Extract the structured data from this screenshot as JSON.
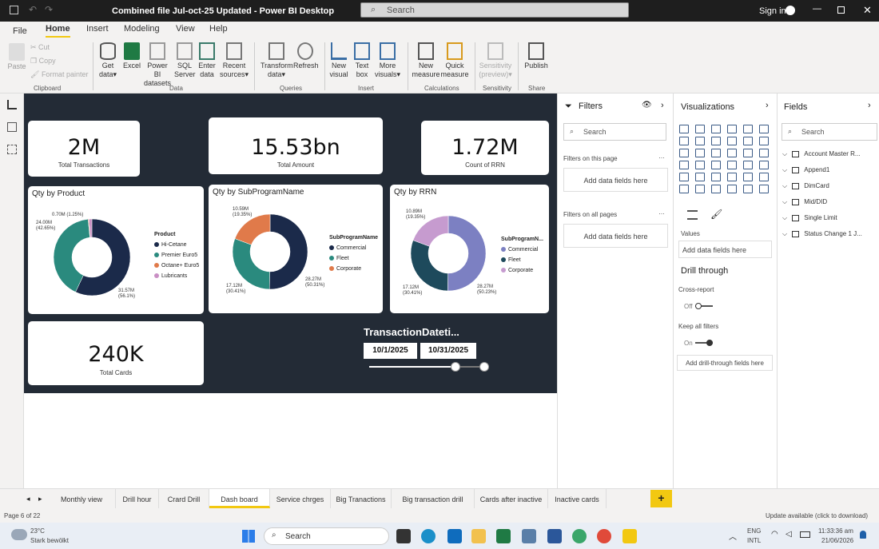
{
  "titlebar": {
    "title": "Combined file Jul-oct-25 Updated - Power BI Desktop",
    "search_placeholder": "Search",
    "signin": "Sign in"
  },
  "menu": {
    "tabs": [
      "File",
      "Home",
      "Insert",
      "Modeling",
      "View",
      "Help"
    ],
    "active": "Home"
  },
  "ribbon": {
    "clipboard": {
      "paste": "Paste",
      "cut": "Cut",
      "copy": "Copy",
      "format_painter": "Format painter",
      "group": "Clipboard"
    },
    "data": {
      "get_data": "Get",
      "get_data2": "data",
      "excel": "Excel",
      "pbi1": "Power BI",
      "pbi2": "datasets",
      "sql1": "SQL",
      "sql2": "Server",
      "enter1": "Enter",
      "enter2": "data",
      "recent1": "Recent",
      "recent2": "sources",
      "group": "Data"
    },
    "queries": {
      "transform1": "Transform",
      "transform2": "data",
      "refresh": "Refresh",
      "group": "Queries"
    },
    "insert": {
      "newvisual1": "New",
      "newvisual2": "visual",
      "textbox1": "Text",
      "textbox2": "box",
      "more1": "More",
      "more2": "visuals",
      "group": "Insert"
    },
    "calculations": {
      "newmeasure1": "New",
      "newmeasure2": "measure",
      "quick1": "Quick",
      "quick2": "measure",
      "group": "Calculations"
    },
    "sensitivity": {
      "s1": "Sensitivity",
      "s2": "(preview)",
      "group": "Sensitivity"
    },
    "share": {
      "publish": "Publish",
      "group": "Share"
    }
  },
  "report": {
    "kpis": [
      {
        "value": "2M",
        "label": "Total Transactions"
      },
      {
        "value": "15.53bn",
        "label": "Total Amount"
      },
      {
        "value": "1.72M",
        "label": "Count of RRN"
      },
      {
        "value": "240K",
        "label": "Total Cards"
      }
    ],
    "slicer": {
      "title": "TransactionDateti...",
      "start": "10/1/2025",
      "end": "10/31/2025",
      "range_fill_fraction": 0.75
    }
  },
  "chart_data": [
    {
      "type": "pie",
      "title": "Qty by Product",
      "legend_title": "Product",
      "categories": [
        "Hi-Cetane",
        "Premier Euro5",
        "Octane+ Euro5",
        "Lubricants"
      ],
      "colors": [
        "#1b2a4a",
        "#2a8a7e",
        "#e07a4a",
        "#c98fc4"
      ],
      "values": [
        1.157,
        0.84,
        0.007,
        0.025
      ],
      "data_labels": [
        {
          "text": "31.57M",
          "pct": "(56.1%)"
        },
        {
          "text": "24.00M",
          "pct": "(42.65%)"
        },
        {
          "text": "0.70M (1.25%)",
          "pct": ""
        }
      ]
    },
    {
      "type": "pie",
      "title": "Qty by SubProgramName",
      "legend_title": "SubProgramName",
      "categories": [
        "Commercial",
        "Fleet",
        "Corporate"
      ],
      "colors": [
        "#1b2a4a",
        "#2a8a7e",
        "#e07a4a"
      ],
      "values": [
        50.31,
        30.41,
        19.35
      ],
      "data_labels": [
        {
          "text": "28.27M",
          "pct": "(50.31%)"
        },
        {
          "text": "17.12M",
          "pct": "(30.41%)"
        },
        {
          "text": "10.59M",
          "pct": "(19.35%)"
        }
      ]
    },
    {
      "type": "pie",
      "title": "Qty by RRN",
      "legend_title": "SubProgramN...",
      "categories": [
        "Commercial",
        "Fleet",
        "Corporate"
      ],
      "colors": [
        "#7c80c2",
        "#1e4a5c",
        "#c69bcf"
      ],
      "values": [
        50.23,
        30.41,
        19.35
      ],
      "data_labels": [
        {
          "text": "28.27M",
          "pct": "(50.23%)"
        },
        {
          "text": "17.12M",
          "pct": "(30.41%)"
        },
        {
          "text": "10.89M",
          "pct": "(19.35%)"
        }
      ]
    }
  ],
  "filters": {
    "title": "Filters",
    "search": "Search",
    "on_page": "Filters on this page",
    "on_all": "Filters on all pages",
    "add": "Add data fields here"
  },
  "visualizations": {
    "title": "Visualizations",
    "values": "Values",
    "add_values": "Add data fields here",
    "drill": "Drill through",
    "cross": "Cross-report",
    "off": "Off",
    "keep": "Keep all filters",
    "on": "On",
    "add_drill": "Add drill-through fields here"
  },
  "fields": {
    "title": "Fields",
    "search": "Search",
    "tables": [
      "Account Master R...",
      "Append1",
      "DimCard",
      "Mid/DID",
      "Single Limit",
      "Status Change 1 J..."
    ]
  },
  "pages": {
    "tabs": [
      "Monthly view",
      "Drill hour",
      "Crard Drill",
      "Dash board",
      "Service chrges",
      "Big Tranactions",
      "Big transaction drill",
      "Cards after inactive",
      "Inactive cards"
    ],
    "active": "Dash board",
    "add": "+"
  },
  "status": {
    "page": "Page 6 of 22",
    "update": "Update available (click to download)"
  },
  "taskbar": {
    "temp": "23°C",
    "weather": "Stark bewölkt",
    "search": "Search",
    "lang1": "ENG",
    "lang2": "INTL",
    "time": "11:33:36 am",
    "date": "21/06/2026"
  }
}
